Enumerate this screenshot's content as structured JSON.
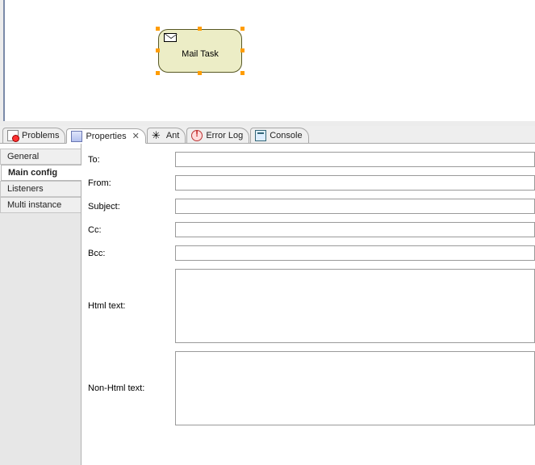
{
  "canvas": {
    "task_label": "Mail Task"
  },
  "view_tabs": {
    "problems": "Problems",
    "properties": "Properties",
    "ant": "Ant",
    "error_log": "Error Log",
    "console": "Console"
  },
  "side_tabs": {
    "general": "General",
    "main_config": "Main config",
    "listeners": "Listeners",
    "multi_instance": "Multi instance"
  },
  "form": {
    "to_label": "To:",
    "to_value": "",
    "from_label": "From:",
    "from_value": "",
    "subject_label": "Subject:",
    "subject_value": "",
    "cc_label": "Cc:",
    "cc_value": "",
    "bcc_label": "Bcc:",
    "bcc_value": "",
    "html_label": "Html text:",
    "html_value": "",
    "nonhtml_label": "Non-Html text:",
    "nonhtml_value": ""
  }
}
